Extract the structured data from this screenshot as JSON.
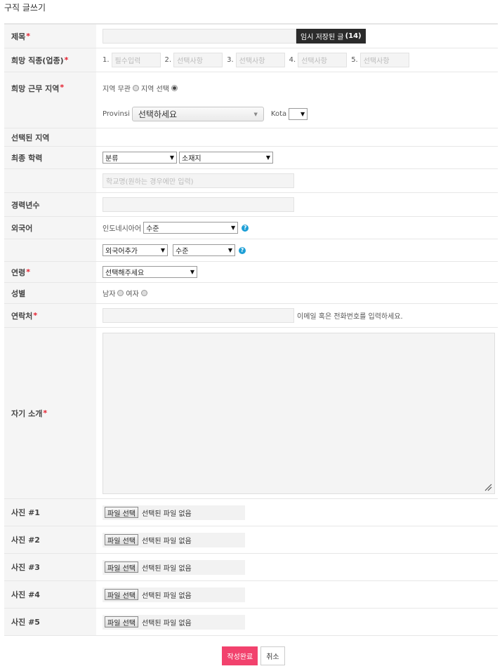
{
  "page": {
    "title": "구직 글쓰기"
  },
  "fields": {
    "title": {
      "label": "제목",
      "required_mark": "*",
      "value": "",
      "draft_button": "임시 저장된 글",
      "draft_count": "(14)"
    },
    "job_type": {
      "label": "희망 직종(업종)",
      "required_mark": "*",
      "items": [
        {
          "num": "1.",
          "placeholder": "필수입력"
        },
        {
          "num": "2.",
          "placeholder": "선택사항"
        },
        {
          "num": "3.",
          "placeholder": "선택사항"
        },
        {
          "num": "4.",
          "placeholder": "선택사항"
        },
        {
          "num": "5.",
          "placeholder": "선택사항"
        }
      ]
    },
    "region": {
      "label": "희망 근무 지역",
      "required_mark": "*",
      "option_any": "지역 무관",
      "option_select": "지역 선택",
      "selected": "지역 선택",
      "provinsi_label": "Provinsi",
      "provinsi_value": "선택하세요",
      "kota_label": "Kota",
      "kota_value": ""
    },
    "selected_region": {
      "label": "선택된 지역"
    },
    "education": {
      "label": "최종 학력",
      "category": "분류",
      "location": "소재지",
      "school_placeholder": "학교명(원하는 경우에만 입력)"
    },
    "experience": {
      "label": "경력년수",
      "value": ""
    },
    "language": {
      "label": "외국어",
      "language_name": "인도네시아어",
      "level": "수준",
      "add_language": "외국어추가",
      "add_level": "수준"
    },
    "age": {
      "label": "연령",
      "required_mark": "*",
      "value": "선택해주세요"
    },
    "gender": {
      "label": "성별",
      "male": "남자",
      "female": "여자"
    },
    "contact": {
      "label": "연락처",
      "required_mark": "*",
      "value": "",
      "hint": "이메일 혹은 전화번호를 입력하세요."
    },
    "intro": {
      "label": "자기 소개",
      "required_mark": "*",
      "value": ""
    },
    "photos": [
      {
        "label": "사진 #1",
        "button": "파일 선택",
        "status": "선택된 파일 없음"
      },
      {
        "label": "사진 #2",
        "button": "파일 선택",
        "status": "선택된 파일 없음"
      },
      {
        "label": "사진 #3",
        "button": "파일 선택",
        "status": "선택된 파일 없음"
      },
      {
        "label": "사진 #4",
        "button": "파일 선택",
        "status": "선택된 파일 없음"
      },
      {
        "label": "사진 #5",
        "button": "파일 선택",
        "status": "선택된 파일 없음"
      }
    ]
  },
  "actions": {
    "submit": "작성완료",
    "cancel": "취소"
  },
  "colors": {
    "required": "#e4202f",
    "submit_bg": "#f2426d",
    "help_icon": "#1e9fd6",
    "label_bg": "#f5f5f5"
  }
}
